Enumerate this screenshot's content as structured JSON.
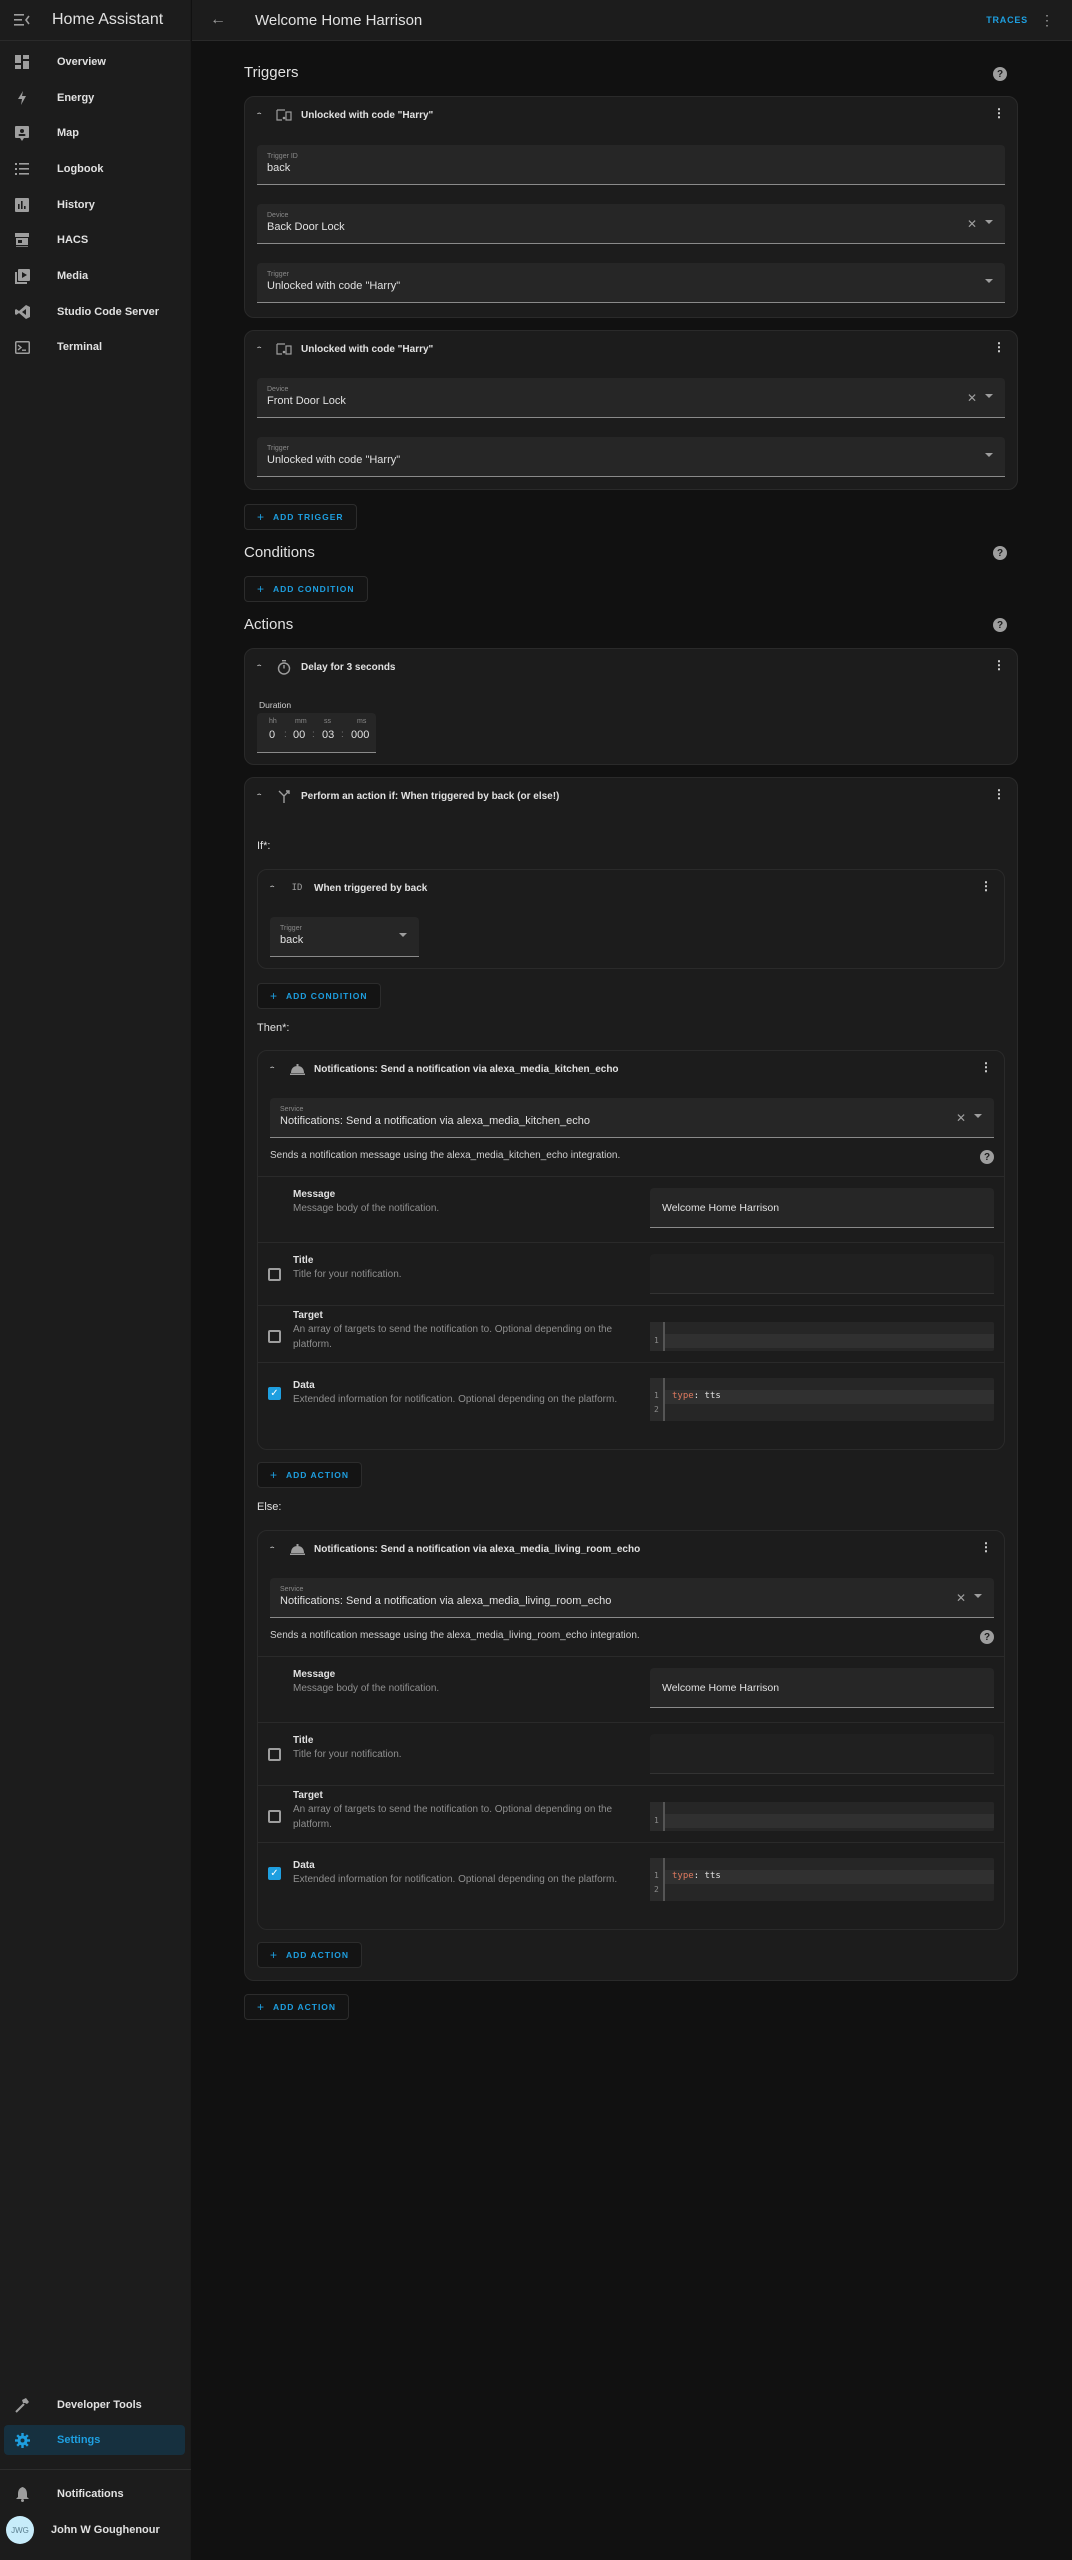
{
  "app": {
    "title": "Home Assistant"
  },
  "sidebar": {
    "items": [
      {
        "label": "Overview",
        "icon": "dashboard-icon"
      },
      {
        "label": "Energy",
        "icon": "lightning-bolt-icon"
      },
      {
        "label": "Map",
        "icon": "map-marker-icon"
      },
      {
        "label": "Logbook",
        "icon": "list-icon"
      },
      {
        "label": "History",
        "icon": "chart-bar-icon"
      },
      {
        "label": "HACS",
        "icon": "hacs-store-icon"
      },
      {
        "label": "Media",
        "icon": "play-box-icon"
      },
      {
        "label": "Studio Code Server",
        "icon": "vscode-icon"
      },
      {
        "label": "Terminal",
        "icon": "console-icon"
      }
    ],
    "bottom": [
      {
        "label": "Developer Tools",
        "icon": "hammer-icon"
      },
      {
        "label": "Settings",
        "icon": "gear-icon",
        "active": true
      }
    ],
    "notifications_label": "Notifications",
    "user": {
      "name": "John W Goughenour",
      "initials": "JWG"
    }
  },
  "topbar": {
    "title": "Welcome Home Harrison",
    "traces_label": "TRACES"
  },
  "triggers": {
    "heading": "Triggers",
    "items": [
      {
        "title": "Unlocked with code \"Harry\"",
        "trigger_id_label": "Trigger ID",
        "trigger_id_value": "back",
        "device_label": "Device",
        "device_value": "Back Door Lock",
        "trigger_label": "Trigger",
        "trigger_value": "Unlocked with code \"Harry\""
      },
      {
        "title": "Unlocked with code \"Harry\"",
        "device_label": "Device",
        "device_value": "Front Door Lock",
        "trigger_label": "Trigger",
        "trigger_value": "Unlocked with code \"Harry\""
      }
    ],
    "add_label": "ADD TRIGGER"
  },
  "conditions": {
    "heading": "Conditions",
    "add_label": "ADD CONDITION"
  },
  "actions": {
    "heading": "Actions",
    "delay": {
      "title": "Delay for 3 seconds",
      "duration_label": "Duration",
      "units": [
        "hh",
        "mm",
        "ss",
        "ms"
      ],
      "values": [
        "0",
        "00",
        "03",
        "000"
      ]
    },
    "choose": {
      "title": "Perform an action if: When triggered by back (or else!)",
      "if_label": "If*:",
      "condition": {
        "title": "When triggered by back",
        "icon_text": "ID",
        "trigger_label": "Trigger",
        "trigger_value": "back"
      },
      "add_condition_label": "ADD CONDITION",
      "then_label": "Then*:",
      "else_label": "Else:",
      "then_action": {
        "title": "Notifications: Send a notification via alexa_media_kitchen_echo",
        "service_label": "Service",
        "service_value": "Notifications: Send a notification via alexa_media_kitchen_echo",
        "description": "Sends a notification message using the alexa_media_kitchen_echo integration.",
        "fields": {
          "message": {
            "name": "Message",
            "desc": "Message body of the notification.",
            "value": "Welcome Home Harrison"
          },
          "title": {
            "name": "Title",
            "desc": "Title for your notification.",
            "checked": false
          },
          "target": {
            "name": "Target",
            "desc": "An array of targets to send the notification to. Optional depending on the platform.",
            "checked": false,
            "line_numbers": [
              "1"
            ]
          },
          "data": {
            "name": "Data",
            "desc": "Extended information for notification. Optional depending on the platform.",
            "checked": true,
            "line_numbers": [
              "1",
              "2"
            ],
            "code_key": "type",
            "code_sep": ":",
            "code_value": " tts"
          }
        }
      },
      "else_action": {
        "title": "Notifications: Send a notification via alexa_media_living_room_echo",
        "service_label": "Service",
        "service_value": "Notifications: Send a notification via alexa_media_living_room_echo",
        "description": "Sends a notification message using the alexa_media_living_room_echo integration.",
        "fields": {
          "message": {
            "name": "Message",
            "desc": "Message body of the notification.",
            "value": "Welcome Home Harrison"
          },
          "title": {
            "name": "Title",
            "desc": "Title for your notification.",
            "checked": false
          },
          "target": {
            "name": "Target",
            "desc": "An array of targets to send the notification to. Optional depending on the platform.",
            "checked": false,
            "line_numbers": [
              "1"
            ]
          },
          "data": {
            "name": "Data",
            "desc": "Extended information for notification. Optional depending on the platform.",
            "checked": true,
            "line_numbers": [
              "1",
              "2"
            ],
            "code_key": "type",
            "code_sep": ":",
            "code_value": " tts"
          }
        }
      },
      "add_action_label": "ADD ACTION"
    },
    "add_label": "ADD ACTION"
  },
  "colors": {
    "accent": "#1e9fe0",
    "background": "#111111",
    "card": "#1c1c1c",
    "field": "#262626",
    "yaml_key": "#e07a5f"
  }
}
